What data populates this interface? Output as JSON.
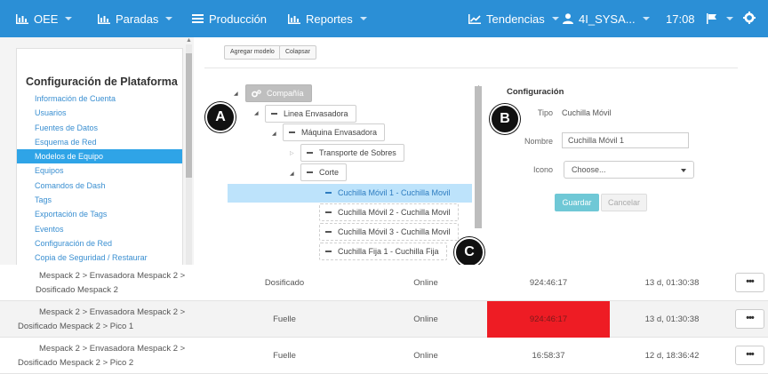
{
  "nav": {
    "oee": "OEE",
    "paradas": "Paradas",
    "produccion": "Producción",
    "reportes": "Reportes",
    "tendencias": "Tendencias",
    "user": "4I_SYSA...",
    "time": "17:08",
    "colors": {
      "bar": "#2b8fd6"
    }
  },
  "sidebar": {
    "title": "Configuración de Plataforma",
    "items": [
      "Información de Cuenta",
      "Usuarios",
      "Fuentes de Datos",
      "Esquema de Red",
      "Modelos de Equipo",
      "Equipos",
      "Comandos de Dash",
      "Tags",
      "Exportación de Tags",
      "Eventos",
      "Configuración de Red",
      "Copia de Seguridad / Restaurar"
    ],
    "active_index": 4
  },
  "toolbar": {
    "add_model": "Agregar modelo",
    "collapse": "Colapsar"
  },
  "tree": {
    "root": "Compañía",
    "level1": "Linea Envasadora",
    "level2": "Máquina Envasadora",
    "transport": "Transporte de Sobres",
    "corte": "Corte",
    "leaves": [
      "Cuchilla Móvil 1 - Cuchilla Movil",
      "Cuchilla Móvil 2 - Cuchilla Movil",
      "Cuchilla Móvil 3 - Cuchilla Movil",
      "Cuchilla Fija 1 - Cuchilla Fija"
    ]
  },
  "config": {
    "title": "Configuración",
    "tipo_label": "Tipo",
    "tipo_value": "Cuchilla Móvil",
    "nombre_label": "Nombre",
    "nombre_value": "Cuchilla Móvil 1",
    "icono_label": "Icono",
    "icono_value": "Choose...",
    "save": "Guardar",
    "cancel": "Cancelar"
  },
  "markers": {
    "a": "A",
    "b": "B",
    "c": "C"
  },
  "table": {
    "rows": [
      {
        "path1": "Mespack 2 > Envasadora Mespack 2 >",
        "path2": "Dosificado Mespack 2",
        "type": "Dosificado",
        "status": "Online",
        "time": "924:46:17",
        "duration": "13 d, 01:30:38",
        "alert": false
      },
      {
        "path1": "Mespack 2 > Envasadora Mespack 2 >",
        "path2": "Dosificado Mespack 2 > Pico 1",
        "type": "Fuelle",
        "status": "Online",
        "time": "924:46:17",
        "duration": "13 d, 01:30:38",
        "alert": true
      },
      {
        "path1": "Mespack 2 > Envasadora Mespack 2 >",
        "path2": "Dosificado Mespack 2 > Pico 2",
        "type": "Fuelle",
        "status": "Online",
        "time": "16:58:37",
        "duration": "12 d, 18:36:42",
        "alert": false
      }
    ],
    "more": "•••",
    "colors": {
      "alert": "#ee1c24"
    }
  }
}
